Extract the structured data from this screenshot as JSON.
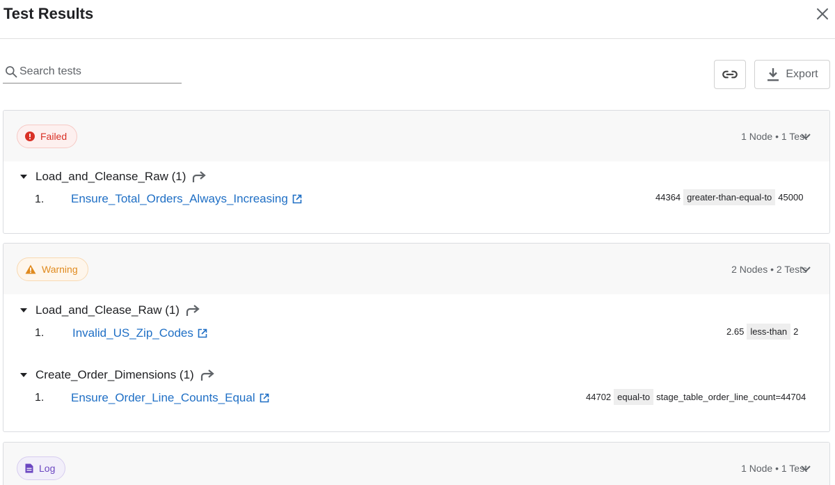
{
  "header": {
    "title": "Test Results"
  },
  "search": {
    "placeholder": "Search tests"
  },
  "toolbar": {
    "export_label": "Export"
  },
  "groups": [
    {
      "status": "Failed",
      "summary": "1 Node • 1 Test",
      "nodes": [
        {
          "label": "Load_and_Cleanse_Raw (1)",
          "tests": [
            {
              "num": "1.",
              "name": "Ensure_Total_Orders_Always_Increasing",
              "actual": "44364",
              "op": "greater-than-equal-to",
              "expected": "45000"
            }
          ]
        }
      ]
    },
    {
      "status": "Warning",
      "summary": "2 Nodes • 2 Tests",
      "nodes": [
        {
          "label": "Load_and_Clease_Raw (1)",
          "tests": [
            {
              "num": "1.",
              "name": "Invalid_US_Zip_Codes",
              "actual": "2.65",
              "op": "less-than",
              "expected": "2"
            }
          ]
        },
        {
          "label": "Create_Order_Dimensions (1)",
          "tests": [
            {
              "num": "1.",
              "name": "Ensure_Order_Line_Counts_Equal",
              "actual": "44702",
              "op": "equal-to",
              "expected": "stage_table_order_line_count=44704"
            }
          ]
        }
      ]
    },
    {
      "status": "Log",
      "summary": "1 Node • 1 Test",
      "nodes": []
    }
  ],
  "colors": {
    "failed": "#d93025",
    "warning": "#e08a1e",
    "log": "#6b46c1",
    "link": "#1f6fc5"
  },
  "icons": [
    "close-icon",
    "search-icon",
    "link-icon",
    "download-icon",
    "error-icon",
    "warning-icon",
    "document-icon",
    "chevron-down-icon",
    "forward-arrow-icon",
    "open-in-new-icon",
    "expand-triangle-icon"
  ]
}
